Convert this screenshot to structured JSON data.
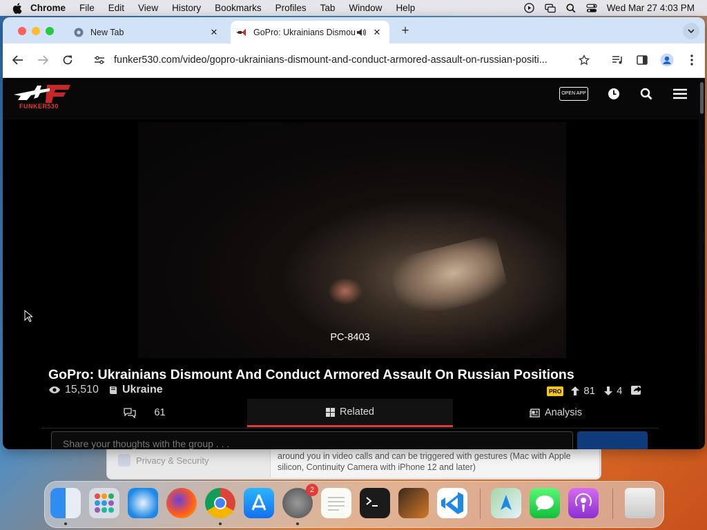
{
  "menubar": {
    "app": "Chrome",
    "items": [
      "File",
      "Edit",
      "View",
      "History",
      "Bookmarks",
      "Profiles",
      "Tab",
      "Window",
      "Help"
    ],
    "clock": "Wed Mar 27  4:03 PM"
  },
  "background_window": {
    "sidebar_item": "Privacy & Security",
    "description": "around you in video calls and can be triggered with gestures (Mac with Apple silicon, Continuity Camera with iPhone 12 and later)"
  },
  "browser": {
    "tabs": [
      {
        "title": "New Tab"
      },
      {
        "title": "GoPro: Ukrainians Dismou"
      }
    ],
    "url": "funker530.com/video/gopro-ukrainians-dismount-and-conduct-armored-assault-on-russian-positi..."
  },
  "site": {
    "logo_text": "FUNKER530",
    "open_app": "OPEN APP"
  },
  "video": {
    "caption": "PC-8403",
    "title": "GoPro: Ukrainians Dismount And Conduct Armored Assault On Russian Positions",
    "views": "15,510",
    "category": "Ukraine",
    "pro_badge": "PRO",
    "upvotes": "81",
    "downvotes": "4"
  },
  "page_tabs": {
    "comments_count": "61",
    "related": "Related",
    "analysis": "Analysis"
  },
  "comment": {
    "placeholder": "Share your thoughts with the group . . ."
  },
  "dock": {
    "apps": [
      "Finder",
      "Launchpad",
      "Safari",
      "Firefox",
      "Chrome",
      "App Store",
      "System Settings",
      "TextEdit",
      "Terminal",
      "GarageBand",
      "Visual Studio Code",
      "Maps",
      "Messages",
      "Podcasts",
      "Trash"
    ],
    "settings_badge": "2"
  }
}
